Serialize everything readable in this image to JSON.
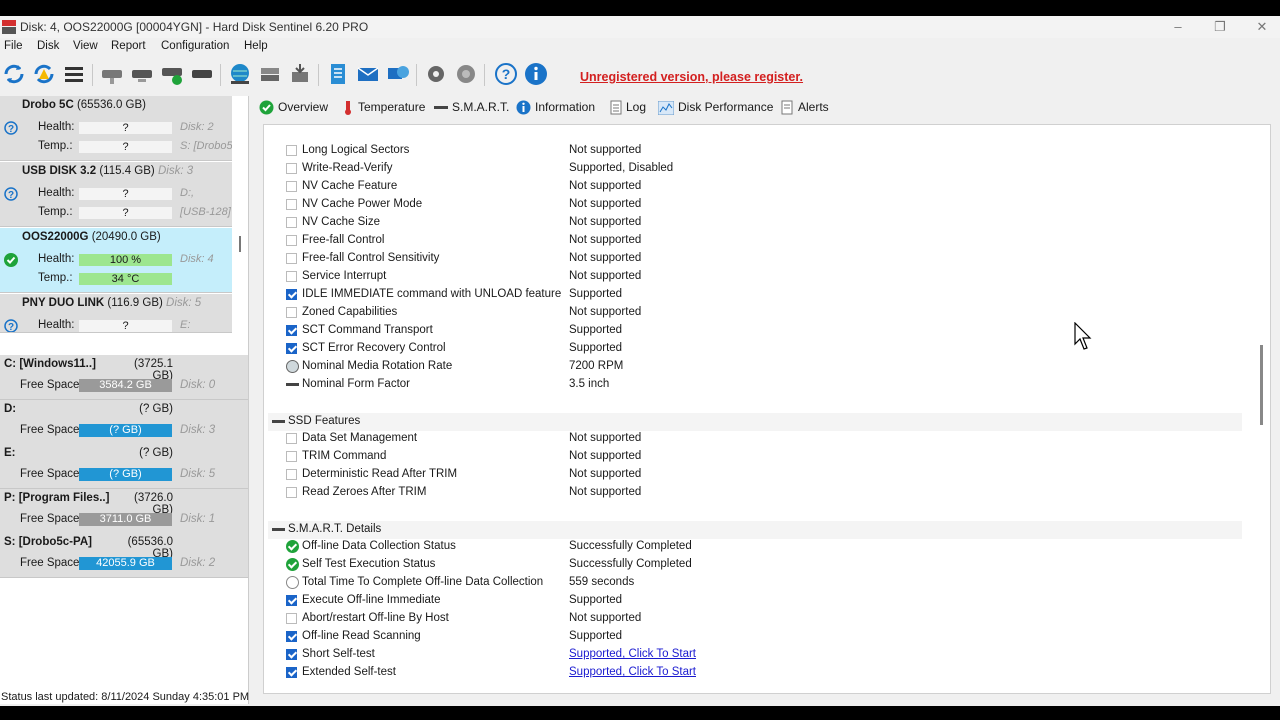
{
  "window": {
    "title": "Disk: 4, OOS22000G [00004YGN]  -  Hard Disk Sentinel 6.20 PRO"
  },
  "menu": [
    {
      "label": "File"
    },
    {
      "label": "Disk"
    },
    {
      "label": "View"
    },
    {
      "label": "Report"
    },
    {
      "label": "Configuration"
    },
    {
      "label": "Help"
    }
  ],
  "toolbar": {
    "register_text": "Unregistered version, please register.",
    "icons": [
      "refresh-icon",
      "refresh-warning-icon",
      "disk-list-icon",
      "disk-gray-icon",
      "disk-remove-icon",
      "disk-check-icon",
      "disk-flat-icon",
      "globe-icon",
      "disk-network-icon",
      "disk-save-icon",
      "report-icon",
      "email-icon",
      "send-report-icon",
      "settings-icon",
      "advanced-settings-icon",
      "help-icon",
      "info-icon"
    ]
  },
  "disks": [
    {
      "name": "Drobo 5C",
      "capacity": "(65536.0 GB)",
      "disk_no": "",
      "health_label": "Health:",
      "health": "?",
      "temp_label": "Temp.:",
      "temp": "?",
      "extra1": "Disk: 2",
      "extra2": "S: [Drobo5",
      "status": "unknown"
    },
    {
      "name": "USB DISK 3.2",
      "capacity": "(115.4 GB)",
      "disk_no": "Disk: 3",
      "health_label": "Health:",
      "health": "?",
      "temp_label": "Temp.:",
      "temp": "?",
      "extra1": "D:,",
      "extra2": "[USB-128]",
      "status": "unknown"
    },
    {
      "name": "OOS22000G",
      "capacity": "(20490.0 GB)",
      "disk_no": "",
      "health_label": "Health:",
      "health": "100 %",
      "temp_label": "Temp.:",
      "temp": "34 °C",
      "extra1": "Disk: 4",
      "extra2": "",
      "status": "ok"
    },
    {
      "name": "PNY DUO LINK",
      "capacity": "(116.9 GB)",
      "disk_no": "Disk: 5",
      "health_label": "Health:",
      "health": "?",
      "temp_label": "",
      "temp": "",
      "extra1": "E:",
      "extra2": "",
      "status": "unknown"
    }
  ],
  "volumes": [
    {
      "name": "C: [Windows11..]",
      "size": "(3725.1 GB)",
      "label": "Free Space",
      "free": "3584.2 GB",
      "disk": "Disk: 0",
      "color": "#9a9a9a"
    },
    {
      "name": "D:",
      "size": "(? GB)",
      "label": "Free Space",
      "free": "(? GB)",
      "disk": "Disk: 3",
      "color": "#2196d4"
    },
    {
      "name": "E:",
      "size": "(? GB)",
      "label": "Free Space",
      "free": "(? GB)",
      "disk": "Disk: 5",
      "color": "#2196d4"
    },
    {
      "name": "P: [Program Files..]",
      "size": "(3726.0 GB)",
      "label": "Free Space",
      "free": "3711.0 GB",
      "disk": "Disk: 1",
      "color": "#9a9a9a"
    },
    {
      "name": "S: [Drobo5c-PA]",
      "size": "(65536.0 GB)",
      "label": "Free Space",
      "free": "42055.9 GB",
      "disk": "Disk: 2",
      "color": "#2196d4"
    }
  ],
  "tabs": [
    {
      "label": "Overview"
    },
    {
      "label": "Temperature"
    },
    {
      "label": "S.M.A.R.T."
    },
    {
      "label": "Information"
    },
    {
      "label": "Log"
    },
    {
      "label": "Disk Performance"
    },
    {
      "label": "Alerts"
    }
  ],
  "info_rows": [
    {
      "type": "row",
      "icon": "chk",
      "name": "Long Logical Sectors",
      "value": "Not supported"
    },
    {
      "type": "row",
      "icon": "chk",
      "name": "Write-Read-Verify",
      "value": "Supported, Disabled"
    },
    {
      "type": "row",
      "icon": "chk",
      "name": "NV Cache Feature",
      "value": "Not supported"
    },
    {
      "type": "row",
      "icon": "chk",
      "name": "NV Cache Power Mode",
      "value": "Not supported"
    },
    {
      "type": "row",
      "icon": "chk",
      "name": "NV Cache Size",
      "value": "Not supported"
    },
    {
      "type": "row",
      "icon": "chk",
      "name": "Free-fall Control",
      "value": "Not supported"
    },
    {
      "type": "row",
      "icon": "chk",
      "name": "Free-fall Control Sensitivity",
      "value": "Not supported"
    },
    {
      "type": "row",
      "icon": "chk",
      "name": "Service Interrupt",
      "value": "Not supported"
    },
    {
      "type": "row",
      "icon": "chk-on",
      "name": "IDLE IMMEDIATE command with UNLOAD feature",
      "value": "Supported"
    },
    {
      "type": "row",
      "icon": "chk",
      "name": "Zoned Capabilities",
      "value": "Not supported"
    },
    {
      "type": "row",
      "icon": "chk-on",
      "name": "SCT Command Transport",
      "value": "Supported"
    },
    {
      "type": "row",
      "icon": "chk-on",
      "name": "SCT Error Recovery Control",
      "value": "Supported"
    },
    {
      "type": "row",
      "icon": "disc",
      "name": "Nominal Media Rotation Rate",
      "value": "7200 RPM"
    },
    {
      "type": "row",
      "icon": "dash",
      "name": "Nominal Form Factor",
      "value": "3.5 inch"
    },
    {
      "type": "gap"
    },
    {
      "type": "section",
      "name": "SSD Features"
    },
    {
      "type": "row",
      "icon": "chk",
      "name": "Data Set Management",
      "value": "Not supported"
    },
    {
      "type": "row",
      "icon": "chk",
      "name": "TRIM Command",
      "value": "Not supported"
    },
    {
      "type": "row",
      "icon": "chk",
      "name": "Deterministic Read After TRIM",
      "value": "Not supported"
    },
    {
      "type": "row",
      "icon": "chk",
      "name": "Read Zeroes After TRIM",
      "value": "Not supported"
    },
    {
      "type": "gap"
    },
    {
      "type": "section",
      "name": "S.M.A.R.T. Details"
    },
    {
      "type": "row",
      "icon": "ok",
      "name": "Off-line Data Collection Status",
      "value": "Successfully Completed"
    },
    {
      "type": "row",
      "icon": "ok",
      "name": "Self Test Execution Status",
      "value": "Successfully Completed"
    },
    {
      "type": "row",
      "icon": "clk",
      "name": "Total Time To Complete Off-line Data Collection",
      "value": "559 seconds"
    },
    {
      "type": "row",
      "icon": "chk-on",
      "name": "Execute Off-line Immediate",
      "value": "Supported"
    },
    {
      "type": "row",
      "icon": "chk",
      "name": "Abort/restart Off-line By Host",
      "value": "Not supported"
    },
    {
      "type": "row",
      "icon": "chk-on",
      "name": "Off-line Read Scanning",
      "value": "Supported"
    },
    {
      "type": "row",
      "icon": "chk-on",
      "name": "Short Self-test",
      "value": "Supported, Click To Start",
      "link": true
    },
    {
      "type": "row",
      "icon": "chk-on",
      "name": "Extended Self-test",
      "value": "Supported, Click To Start",
      "link": true
    }
  ],
  "status": {
    "text": "Status last updated: 8/11/2024 Sunday 4:35:01 PM"
  }
}
